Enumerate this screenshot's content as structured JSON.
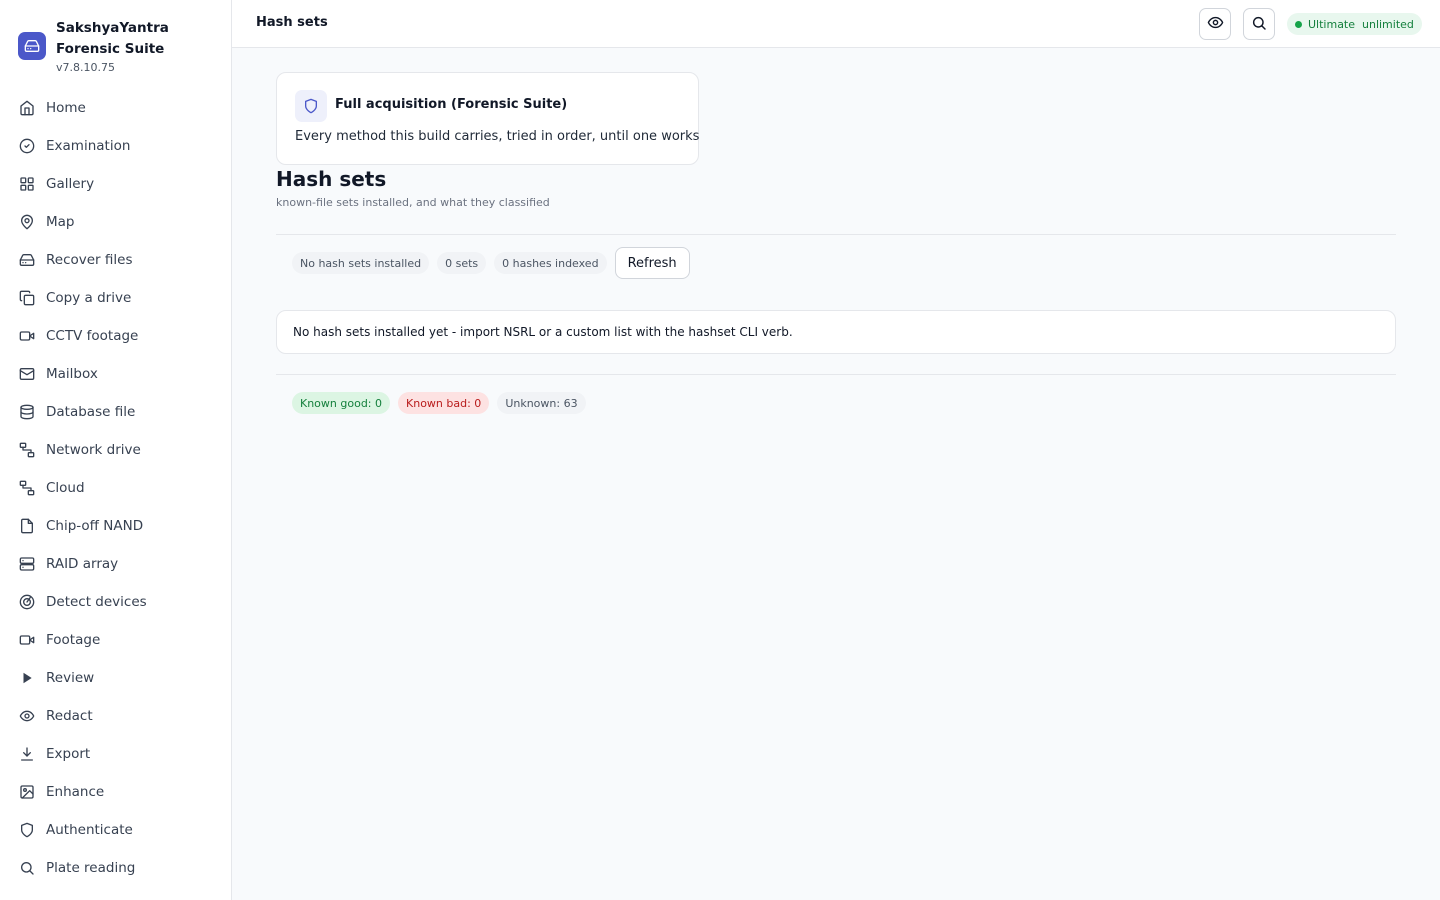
{
  "brand": {
    "name": "SakshyaYantra Forensic Suite",
    "version": "v7.8.10.75"
  },
  "sidebar": {
    "items": [
      {
        "label": "Home",
        "icon": "home-icon"
      },
      {
        "label": "Examination",
        "icon": "check-circle-icon"
      },
      {
        "label": "Gallery",
        "icon": "grid-icon"
      },
      {
        "label": "Map",
        "icon": "map-pin-icon"
      },
      {
        "label": "Recover files",
        "icon": "hard-drive-icon"
      },
      {
        "label": "Copy a drive",
        "icon": "copy-icon"
      },
      {
        "label": "CCTV footage",
        "icon": "video-icon"
      },
      {
        "label": "Mailbox",
        "icon": "mail-icon"
      },
      {
        "label": "Database file",
        "icon": "database-icon"
      },
      {
        "label": "Network drive",
        "icon": "network-icon"
      },
      {
        "label": "Cloud",
        "icon": "network-icon"
      },
      {
        "label": "Chip-off NAND",
        "icon": "file-icon"
      },
      {
        "label": "RAID array",
        "icon": "server-icon"
      },
      {
        "label": "Detect devices",
        "icon": "radar-icon"
      },
      {
        "label": "Footage",
        "icon": "video-icon"
      },
      {
        "label": "Review",
        "icon": "play-icon"
      },
      {
        "label": "Redact",
        "icon": "eye-icon"
      },
      {
        "label": "Export",
        "icon": "download-icon"
      },
      {
        "label": "Enhance",
        "icon": "image-icon"
      },
      {
        "label": "Authenticate",
        "icon": "shield-icon"
      },
      {
        "label": "Plate reading",
        "icon": "search-icon"
      }
    ]
  },
  "header": {
    "title": "Hash sets",
    "plan_badge": "Ultimate  unlimited",
    "plan_color": "#15803d"
  },
  "acquisition_card": {
    "title": "Full acquisition (Forensic Suite)",
    "description": "Every method this build carries, tried in order, until one works"
  },
  "page": {
    "title": "Hash sets",
    "subtitle": "known-file sets installed, and what they classified"
  },
  "stats": {
    "status": "No hash sets installed",
    "sets": "0 sets",
    "hashes": "0 hashes indexed",
    "refresh_label": "Refresh"
  },
  "empty_message": "No hash sets installed yet - import NSRL or a custom list with the hashset CLI verb.",
  "classification": {
    "known_good": "Known good: 0",
    "known_bad": "Known bad: 0",
    "unknown": "Unknown: 63"
  }
}
